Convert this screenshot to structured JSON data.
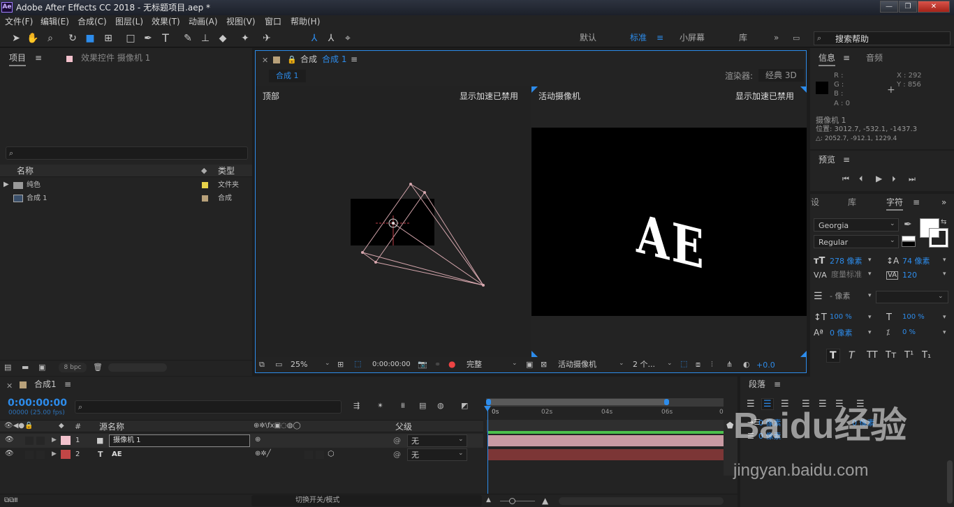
{
  "app": {
    "logo": "Ae",
    "title": "Adobe After Effects CC 2018 - 无标题项目.aep *",
    "min": "—",
    "restore": "❐",
    "close": "✕"
  },
  "menu": [
    "文件(F)",
    "编辑(E)",
    "合成(C)",
    "图层(L)",
    "效果(T)",
    "动画(A)",
    "视图(V)",
    "窗口",
    "帮助(H)"
  ],
  "workspaces": [
    "默认",
    "标准",
    "小屏幕",
    "库"
  ],
  "active_workspace": "标准",
  "search_help": "搜索帮助",
  "project": {
    "tab": "项目",
    "effects_tab": "效果控件 摄像机 1",
    "col_name": "名称",
    "col_type": "类型",
    "items": [
      {
        "name": "纯色",
        "type": "文件夹",
        "color": "#e6d24a"
      },
      {
        "name": "合成 1",
        "type": "合成",
        "color": "#b8a17a"
      }
    ],
    "bpc": "8 bpc"
  },
  "comp": {
    "tab_prefix": "合成",
    "tab_name": "合成 1",
    "subtab": "合成 1",
    "renderer_label": "渲染器:",
    "renderer": "经典 3D",
    "left_view": "顶部",
    "right_view": "活动摄像机",
    "accel_left": "显示加速已禁用",
    "accel_right": "显示加速已禁用",
    "render_text": "AE",
    "zoom": "25%",
    "timecode": "0:00:00:00",
    "quality": "完整",
    "camera": "活动摄像机",
    "views": "2 个...",
    "exposure": "+0.0"
  },
  "info": {
    "tab": "信息",
    "audio_tab": "音频",
    "r": "R :",
    "g": "G :",
    "b": "B :",
    "a": "A : 0",
    "x": "X : 292",
    "y": "Y : 856",
    "layer": "摄像机 1",
    "pos": "位置: 3012.7, -532.1, -1437.3",
    "delta": "△: 2052.7, -912.1, 1229.4"
  },
  "preview": {
    "tab": "预览"
  },
  "character": {
    "tab1": "设",
    "tab2": "库",
    "tab3": "字符",
    "font": "Georgia",
    "style": "Regular",
    "size": "278 像素",
    "leading": "74 像素",
    "kerning": "度量标准",
    "tracking": "120",
    "stroke": "- 像素",
    "vscale": "100 %",
    "hscale": "100 %",
    "baseline": "0 像素",
    "tsume": "0 %",
    "styles": [
      "T",
      "T",
      "TT",
      "Tт",
      "T¹",
      "T₁"
    ]
  },
  "paragraph": {
    "tab": "段落",
    "indent1": "0 像素",
    "indent2": "0 像素",
    "indent3": "0 像素"
  },
  "timeline": {
    "tab": "合成1",
    "timecode": "0:00:00:00",
    "frames": "00000 (25.00 fps)",
    "col_hash": "#",
    "col_source": "源名称",
    "col_parent": "父级",
    "switch_mode": "切换开关/模式",
    "ticks": [
      "0s",
      "02s",
      "04s",
      "06s",
      "0"
    ],
    "layers": [
      {
        "num": "1",
        "name": "摄像机 1",
        "parent": "无",
        "color": "#f2c1cc",
        "bar": "#c99aa3"
      },
      {
        "num": "2",
        "name": "AE",
        "parent": "无",
        "color": "#c24646",
        "bar": "#7c3636"
      }
    ]
  },
  "watermark": {
    "brand": "Baidu经验",
    "url": "jingyan.baidu.com"
  }
}
